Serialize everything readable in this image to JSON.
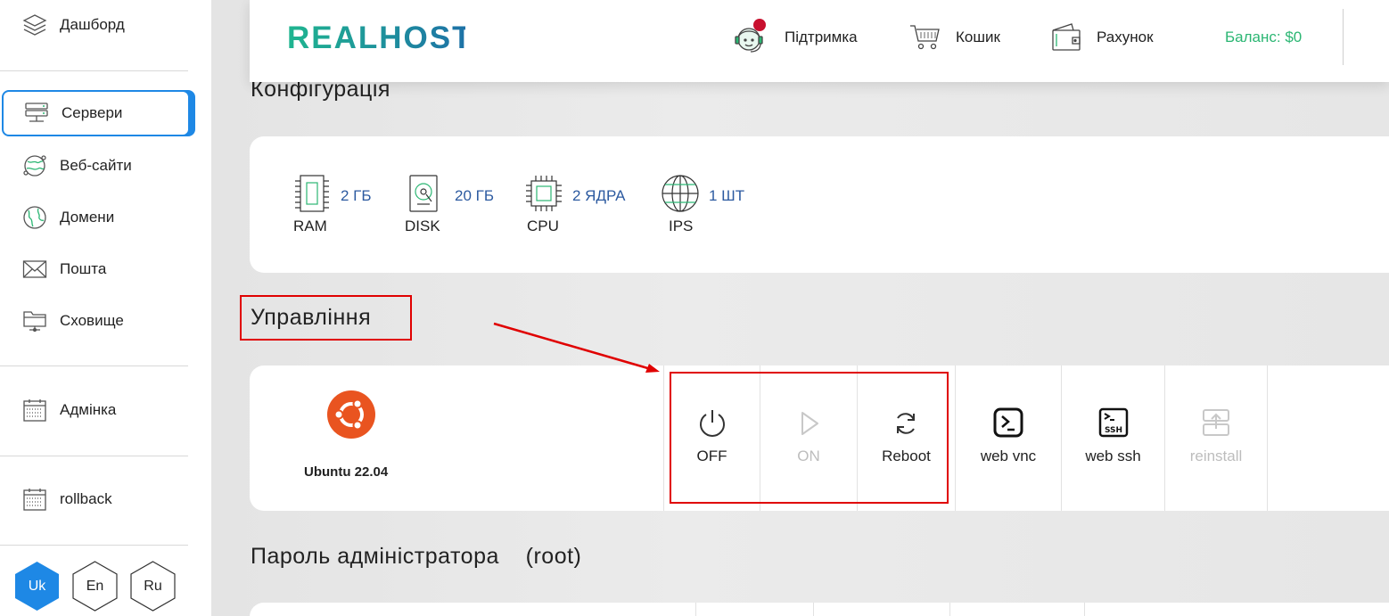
{
  "sidebar": {
    "items": [
      {
        "label": "Дашборд",
        "icon": "layers-icon"
      },
      {
        "label": "Сервери",
        "icon": "server-icon",
        "active": true
      },
      {
        "label": "Веб-сайти",
        "icon": "globe-network-icon"
      },
      {
        "label": "Домени",
        "icon": "globe-icon"
      },
      {
        "label": "Пошта",
        "icon": "mail-icon"
      },
      {
        "label": "Сховище",
        "icon": "folder-icon"
      },
      {
        "label": "Адмінка",
        "icon": "calendar-icon"
      },
      {
        "label": "rollback",
        "icon": "calendar-icon"
      }
    ],
    "languages": [
      {
        "label": "Uk",
        "active": true
      },
      {
        "label": "En"
      },
      {
        "label": "Ru"
      }
    ]
  },
  "header": {
    "logo": "REALHOST",
    "support": "Підтримка",
    "cart": "Кошик",
    "invoice": "Рахунок",
    "balance": "Баланс: $0"
  },
  "config": {
    "title": "Конфігурація",
    "specs": [
      {
        "label": "RAM",
        "value": "2 ГБ"
      },
      {
        "label": "DISK",
        "value": "20 ГБ"
      },
      {
        "label": "CPU",
        "value": "2 ЯДРА"
      },
      {
        "label": "IPS",
        "value": "1 ШТ"
      }
    ]
  },
  "management": {
    "title": "Управління",
    "os": "Ubuntu 22.04",
    "actions": [
      {
        "label": "OFF",
        "enabled": true
      },
      {
        "label": "ON",
        "enabled": false
      },
      {
        "label": "Reboot",
        "enabled": true
      },
      {
        "label": "web vnc",
        "enabled": true
      },
      {
        "label": "web ssh",
        "enabled": true
      },
      {
        "label": "reinstall",
        "enabled": false
      }
    ]
  },
  "password": {
    "title": "Пароль адміністратора    (root)"
  },
  "colors": {
    "accent": "#1e88e5",
    "brand_green": "#2bb673",
    "annotation_red": "#e00000",
    "ubuntu_orange": "#e95420"
  }
}
